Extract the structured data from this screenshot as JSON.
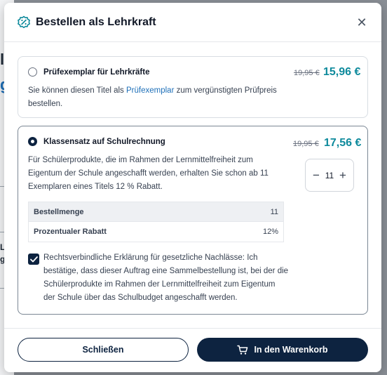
{
  "background": {
    "fragments": [
      "l",
      "g",
      "L",
      "g"
    ]
  },
  "modal": {
    "title": "Bestellen als Lehrkraft",
    "header_icon": "discount-badge-icon",
    "close_icon": "close-icon",
    "close_symbol": "✕"
  },
  "option1": {
    "title": "Prüfexemplar für Lehrkräfte",
    "price_old": "19,95 €",
    "price_new": "15,96 €",
    "desc_before": "Sie können diesen Titel als ",
    "desc_link": "Prüfexemplar",
    "desc_after": " zum vergünstigten Prüfpreis bestellen.",
    "selected": false
  },
  "option2": {
    "title": "Klassensatz auf Schulrechnung",
    "price_old": "19,95 €",
    "price_new": "17,56 €",
    "desc": "Für Schülerprodukte, die im Rahmen der Lernmittelfreiheit zum Eigentum der Schule angeschafft werden, erhalten Sie schon ab 11 Exemplaren eines Titels 12 % Rabatt.",
    "selected": true,
    "stepper": {
      "minus": "−",
      "value": "11",
      "plus": "+"
    },
    "summary": [
      {
        "label": "Bestellmenge",
        "value": "11"
      },
      {
        "label": "Prozentualer Rabatt",
        "value": "12%"
      }
    ],
    "declaration": "Rechtsverbindliche Erklärung für gesetzliche Nachlässe: Ich bestätige, dass dieser Auftrag eine Sammelbestellung ist, bei der die Schülerprodukte im Rahmen der Lernmittelfreiheit zum Eigentum der Schule über das Schulbudget angeschafft werden.",
    "declaration_checked": true
  },
  "footer": {
    "close_label": "Schließen",
    "cart_label": "In den Warenkorb",
    "cart_icon": "shopping-cart-icon"
  },
  "colors": {
    "price": "#0e8a9c",
    "primary": "#0d2340",
    "link": "#1d6fb8"
  }
}
